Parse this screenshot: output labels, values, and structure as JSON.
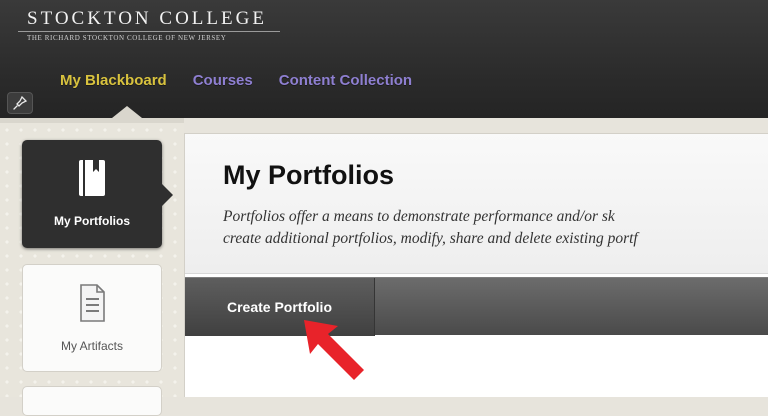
{
  "header": {
    "brand_name": "STOCKTON COLLEGE",
    "brand_sub": "THE RICHARD STOCKTON COLLEGE OF NEW JERSEY",
    "tabs": [
      {
        "label": "My Blackboard",
        "active": true
      },
      {
        "label": "Courses",
        "active": false
      },
      {
        "label": "Content Collection",
        "active": false
      }
    ],
    "pin_icon": "pin-icon"
  },
  "sidebar": {
    "items": [
      {
        "label": "My Portfolios",
        "icon": "book-icon",
        "active": true
      },
      {
        "label": "My Artifacts",
        "icon": "document-icon",
        "active": false
      }
    ]
  },
  "main": {
    "title": "My Portfolios",
    "description_line1": "Portfolios offer a means to demonstrate performance and/or sk",
    "description_line2": "create additional portfolios, modify, share and delete existing portf",
    "create_button": "Create Portfolio"
  },
  "colors": {
    "header_bg": "#2c2c2c",
    "tab_active": "#d8c23e",
    "tab_inactive": "#8e7fd1",
    "accent_arrow": "#e8232a"
  }
}
